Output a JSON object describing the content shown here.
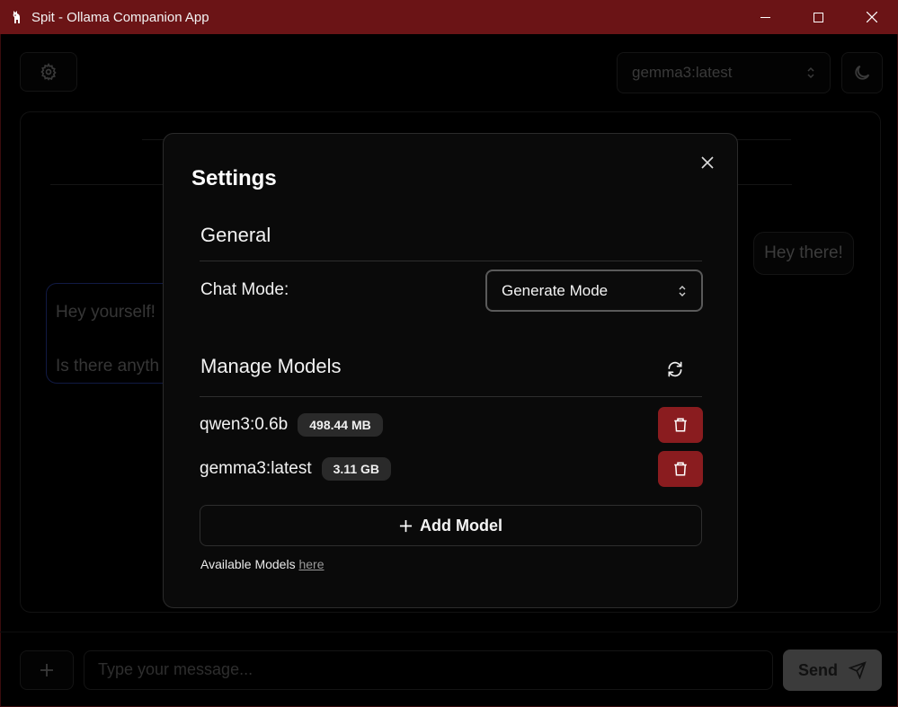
{
  "window": {
    "title": "Spit - Ollama Companion App"
  },
  "header": {
    "selected_model": "gemma3:latest"
  },
  "chat": {
    "user_message": "Hey there!",
    "assistant_line1": "Hey yourself!",
    "assistant_line2": "Is there anyth"
  },
  "composer": {
    "placeholder": "Type your message...",
    "send_label": "Send"
  },
  "settings": {
    "title": "Settings",
    "general_heading": "General",
    "chat_mode_label": "Chat Mode:",
    "chat_mode_value": "Generate Mode",
    "manage_models_heading": "Manage Models",
    "models": [
      {
        "name": "qwen3:0.6b",
        "size": "498.44 MB"
      },
      {
        "name": "gemma3:latest",
        "size": "3.11 GB"
      }
    ],
    "add_model_label": "Add Model",
    "available_prefix": "Available Models",
    "available_link": "here"
  },
  "colors": {
    "titlebar": "#6b1416",
    "delete": "#8a1c1f",
    "modal_bg": "#0a0a0a"
  }
}
